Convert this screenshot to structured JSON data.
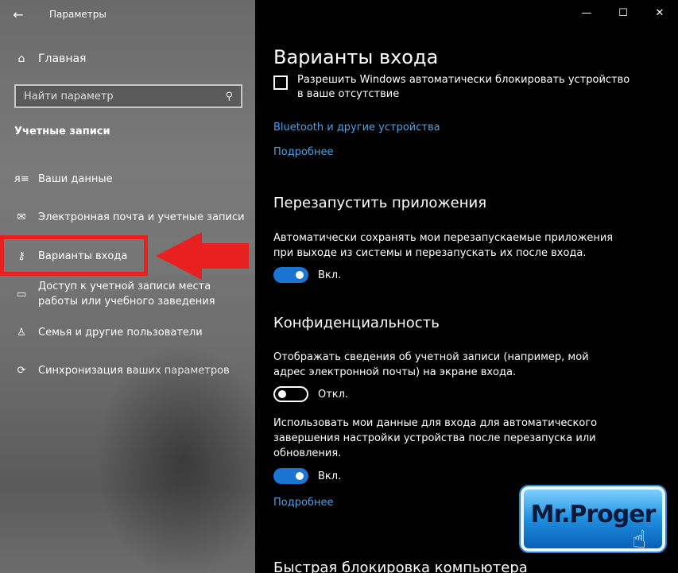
{
  "app": {
    "title": "Параметры"
  },
  "sidebar": {
    "home_label": "Главная",
    "search_placeholder": "Найти параметр",
    "section_title": "Учетные записи",
    "items": [
      {
        "label": "Ваши данные",
        "icon": "person-card-icon"
      },
      {
        "label": "Электронная почта и учетные записи",
        "icon": "mail-icon"
      },
      {
        "label": "Варианты входа",
        "icon": "key-icon",
        "selected": true
      },
      {
        "label": "Доступ к учетной записи места работы или учебного заведения",
        "icon": "briefcase-icon"
      },
      {
        "label": "Семья и другие пользователи",
        "icon": "family-icon"
      },
      {
        "label": "Синхронизация ваших параметров",
        "icon": "sync-icon"
      }
    ]
  },
  "content": {
    "page_title": "Варианты входа",
    "auto_lock_checkbox_label": "Разрешить Windows автоматически блокировать устройство в ваше отсутствие",
    "bluetooth_link": "Bluetooth и другие устройства",
    "more_link_1": "Подробнее",
    "restart_apps": {
      "heading": "Перезапустить приложения",
      "description": "Автоматически сохранять мои перезапускаемые приложения при выходе из системы и перезапускать их после входа.",
      "toggle_label": "Вкл.",
      "toggle_on": true
    },
    "privacy": {
      "heading": "Конфиденциальность",
      "account_info_description": "Отображать сведения об учетной записи (например, мой адрес электронной почты) на экране входа.",
      "account_info_toggle_label": "Откл.",
      "account_info_toggle_on": false,
      "use_signin_description": "Использовать мои данные для входа для автоматического завершения настройки устройства после перезапуска или обновления.",
      "use_signin_toggle_label": "Вкл.",
      "use_signin_toggle_on": true,
      "more_link": "Подробнее"
    },
    "next_heading": "Быстрая блокировка компьютера"
  },
  "watermark": {
    "text": "Mr.Proger"
  },
  "colors": {
    "accent": "#1a74d2",
    "link": "#4aa2e8",
    "highlight": "#e8201f"
  }
}
